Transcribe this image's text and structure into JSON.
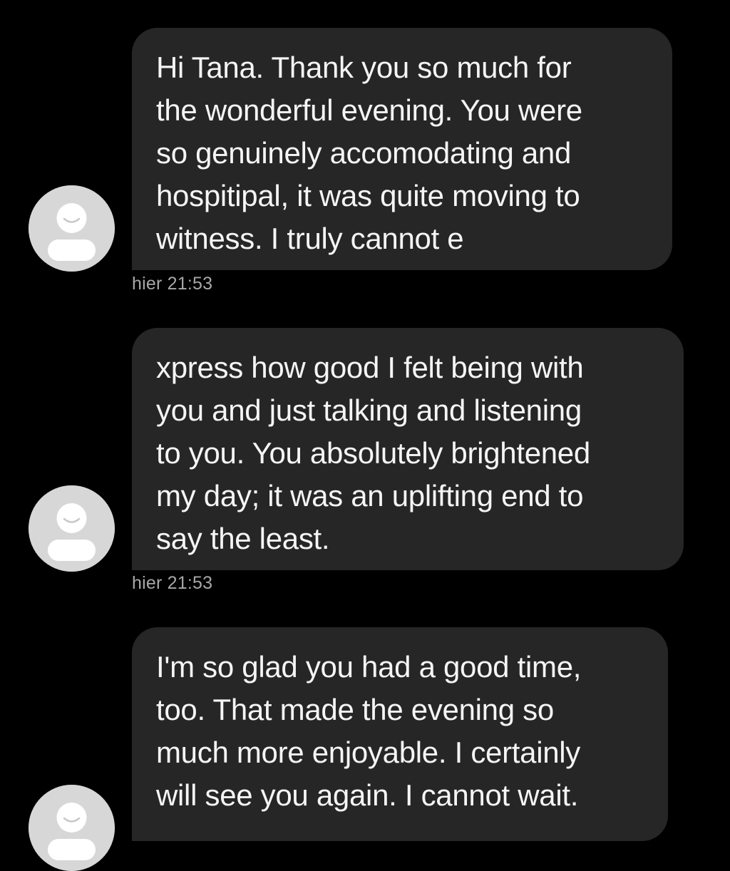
{
  "messages": [
    {
      "lines": [
        "Hi Tana. Thank you so much for",
        "the wonderful evening. You were",
        "so genuinely accomodating and",
        "hospitipal, it was quite moving to",
        "witness. I truly cannot e"
      ],
      "timestamp": "hier 21:53"
    },
    {
      "lines": [
        "xpress how good I felt being with",
        "you and just talking and listening",
        "to you. You absolutely brightened",
        "my day; it was an uplifting end to",
        "say the least."
      ],
      "timestamp": "hier 21:53"
    },
    {
      "lines": [
        "I'm so glad you had a good time,",
        "too. That made the evening so",
        "much more enjoyable. I certainly",
        "will see you again. I cannot wait."
      ],
      "timestamp": ""
    }
  ],
  "avatar_icon": "default-user-avatar-icon",
  "colors": {
    "background": "#000000",
    "bubble": "#262626",
    "text": "#f5f5f5",
    "timestamp": "#a7a7a7",
    "avatar": "#d7d7d7"
  }
}
